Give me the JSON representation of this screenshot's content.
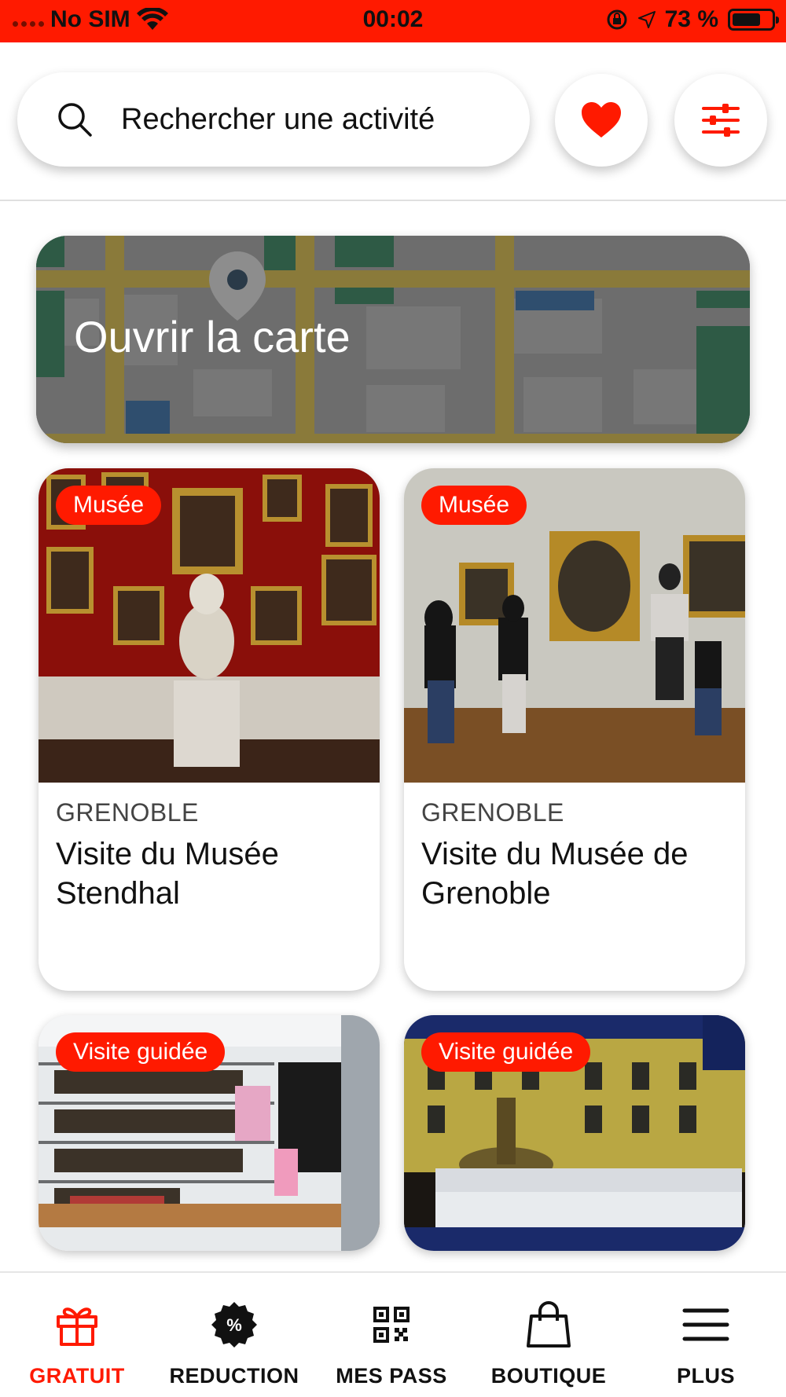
{
  "status_bar": {
    "carrier": "No SIM",
    "time": "00:02",
    "battery": "73 %",
    "battery_level": 0.73
  },
  "header": {
    "search_placeholder": "Rechercher une activité",
    "search_icon": "search-icon",
    "favorites_icon": "heart-icon",
    "filter_icon": "sliders-icon"
  },
  "map_card": {
    "title": "Ouvrir la carte"
  },
  "activities": [
    {
      "tag": "Musée",
      "city": "GRENOBLE",
      "title": "Visite du Musée Stendhal"
    },
    {
      "tag": "Musée",
      "city": "GRENOBLE",
      "title": "Visite du Musée de Grenoble"
    },
    {
      "tag": "Visite guidée",
      "city": "",
      "title": ""
    },
    {
      "tag": "Visite guidée",
      "city": "",
      "title": ""
    }
  ],
  "bottom_nav": {
    "items": [
      {
        "label": "GRATUIT",
        "icon": "gift-icon",
        "active": true
      },
      {
        "label": "REDUCTION",
        "icon": "percent-badge-icon",
        "active": false
      },
      {
        "label": "MES PASS",
        "icon": "qr-code-icon",
        "active": false
      },
      {
        "label": "BOUTIQUE",
        "icon": "shopping-bag-icon",
        "active": false
      },
      {
        "label": "PLUS",
        "icon": "menu-icon",
        "active": false
      }
    ]
  },
  "colors": {
    "accent": "#ff1a00",
    "text": "#111111"
  }
}
